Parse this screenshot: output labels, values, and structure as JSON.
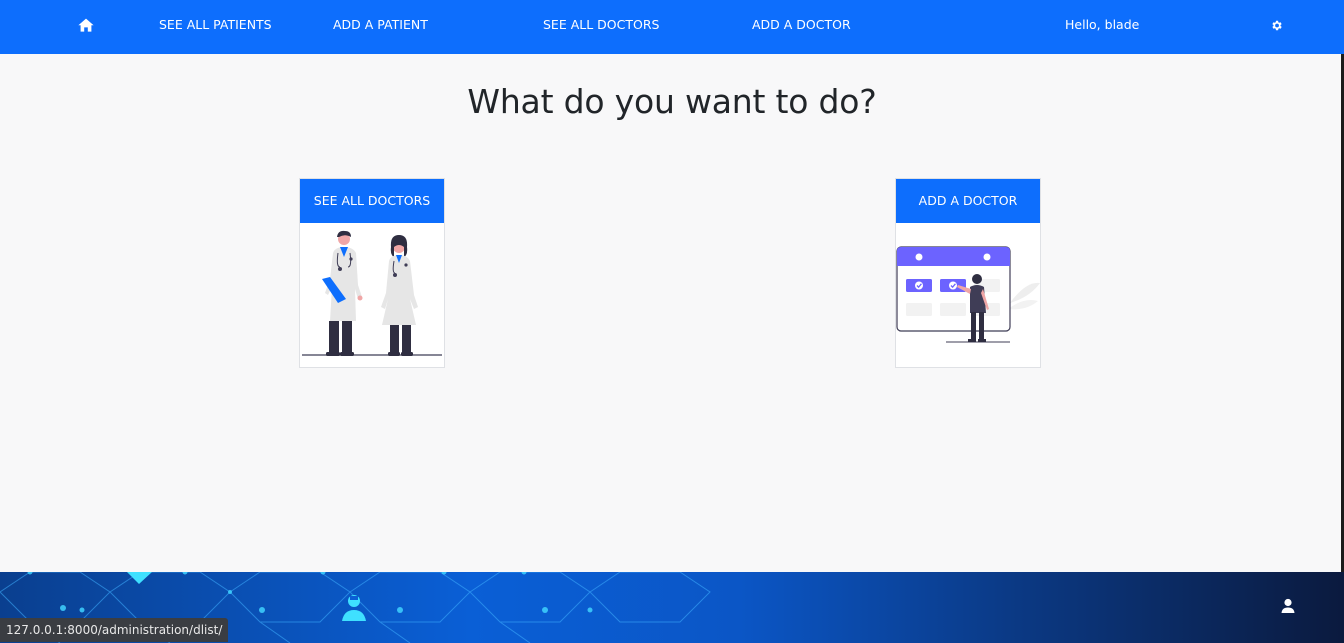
{
  "nav": {
    "home_icon": "home-icon",
    "items": [
      {
        "label": "SEE ALL PATIENTS"
      },
      {
        "label": "ADD A PATIENT"
      },
      {
        "label": "SEE ALL DOCTORS"
      },
      {
        "label": "ADD A DOCTOR"
      }
    ],
    "greeting": "Hello, blade",
    "settings_icon": "gear-icon"
  },
  "main": {
    "heading": "What do you want to do?",
    "cards": [
      {
        "button_label": "SEE ALL DOCTORS",
        "illustration": "doctors-illustration"
      },
      {
        "button_label": "ADD A DOCTOR",
        "illustration": "calendar-illustration"
      }
    ]
  },
  "footer": {
    "user_icon": "user-icon"
  },
  "status_bar": {
    "url": "127.0.0.1:8000/administration/dlist/"
  },
  "colors": {
    "primary": "#0d6efd",
    "background": "#f8f8f9",
    "accent_purple": "#6c63ff"
  }
}
